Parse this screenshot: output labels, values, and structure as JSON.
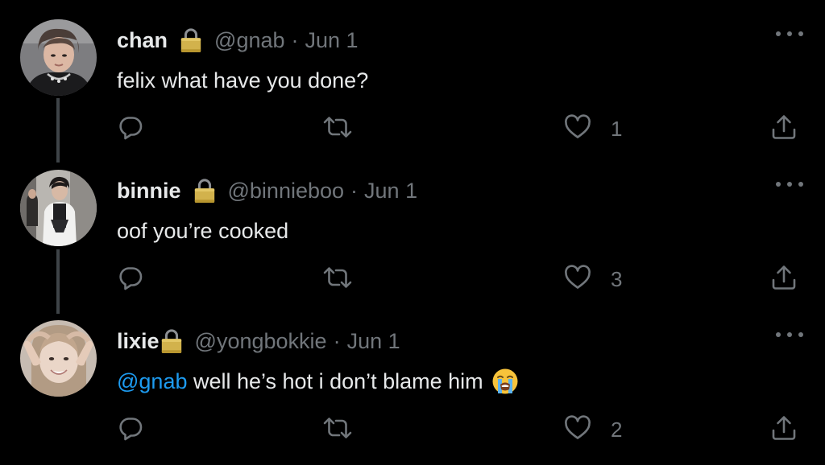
{
  "tweets": [
    {
      "name": "chan",
      "handle": "@gnab",
      "separator": "·",
      "date": "Jun 1",
      "text": "felix what have you done?",
      "mention": "",
      "like_count": "1",
      "avatar_icon": "avatar-photo"
    },
    {
      "name": "binnie",
      "handle": "@binnieboo",
      "separator": "·",
      "date": "Jun 1",
      "text": "oof you’re cooked",
      "mention": "",
      "like_count": "3",
      "avatar_icon": "avatar-photo"
    },
    {
      "name": "lixie",
      "handle": "@yongbokkie",
      "separator": "·",
      "date": "Jun 1",
      "text": " well he’s hot i don’t blame him",
      "mention": "@gnab",
      "like_count": "2",
      "emoji": "loudly-crying-face",
      "avatar_icon": "avatar-photo"
    }
  ],
  "icons": {
    "lock": "lock-icon",
    "more": "more-icon",
    "reply": "reply-icon",
    "retweet": "retweet-icon",
    "like": "heart-icon",
    "share": "share-icon"
  },
  "colors": {
    "background": "#000000",
    "text": "#e7e9ea",
    "muted": "#71767b",
    "link": "#1d9bf0",
    "thread_line": "#3f4448"
  }
}
